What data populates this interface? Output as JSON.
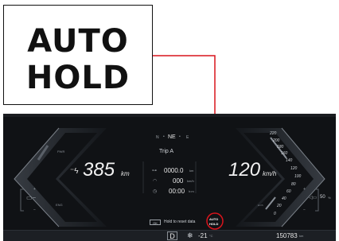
{
  "callout": {
    "line1": "AUTO",
    "line2": "HOLD"
  },
  "colors": {
    "highlight": "#d8141c",
    "background": "#101215",
    "text": "#e6e6e6"
  },
  "compass": {
    "n": "N",
    "heading": "NE",
    "e": "E"
  },
  "trip": {
    "title": "Trip A",
    "distance": "0000.0",
    "distance_unit": "km",
    "speed": "000",
    "speed_unit": "km/h",
    "time": "00:00",
    "time_unit": "h:m"
  },
  "left_gauge": {
    "pwr_label": "PWR",
    "eng_label": "ENG",
    "range": "385",
    "range_unit": "km",
    "icon": "ev-charge-icon"
  },
  "right_gauge": {
    "speed": "120",
    "speed_unit": "km/h",
    "ticks": [
      "220",
      "200",
      "180",
      "160",
      "140",
      "120",
      "100",
      "80",
      "60",
      "40",
      "20",
      "0"
    ],
    "left_ticks": [
      "220"
    ],
    "unit_label": "km/h"
  },
  "status": {
    "left_symbol": "▭−",
    "right_symbol": "◁▭",
    "right_percent": "50",
    "right_percent_unit": "%"
  },
  "hint": {
    "button": "OK",
    "text": "Hold to reset data"
  },
  "autohold_indicator": {
    "line1": "AUTO",
    "line2": "HOLD"
  },
  "bottom_bar": {
    "gear": "D",
    "temp": "-21",
    "temp_unit": "°C",
    "odometer": "150783",
    "odometer_unit": "km"
  }
}
